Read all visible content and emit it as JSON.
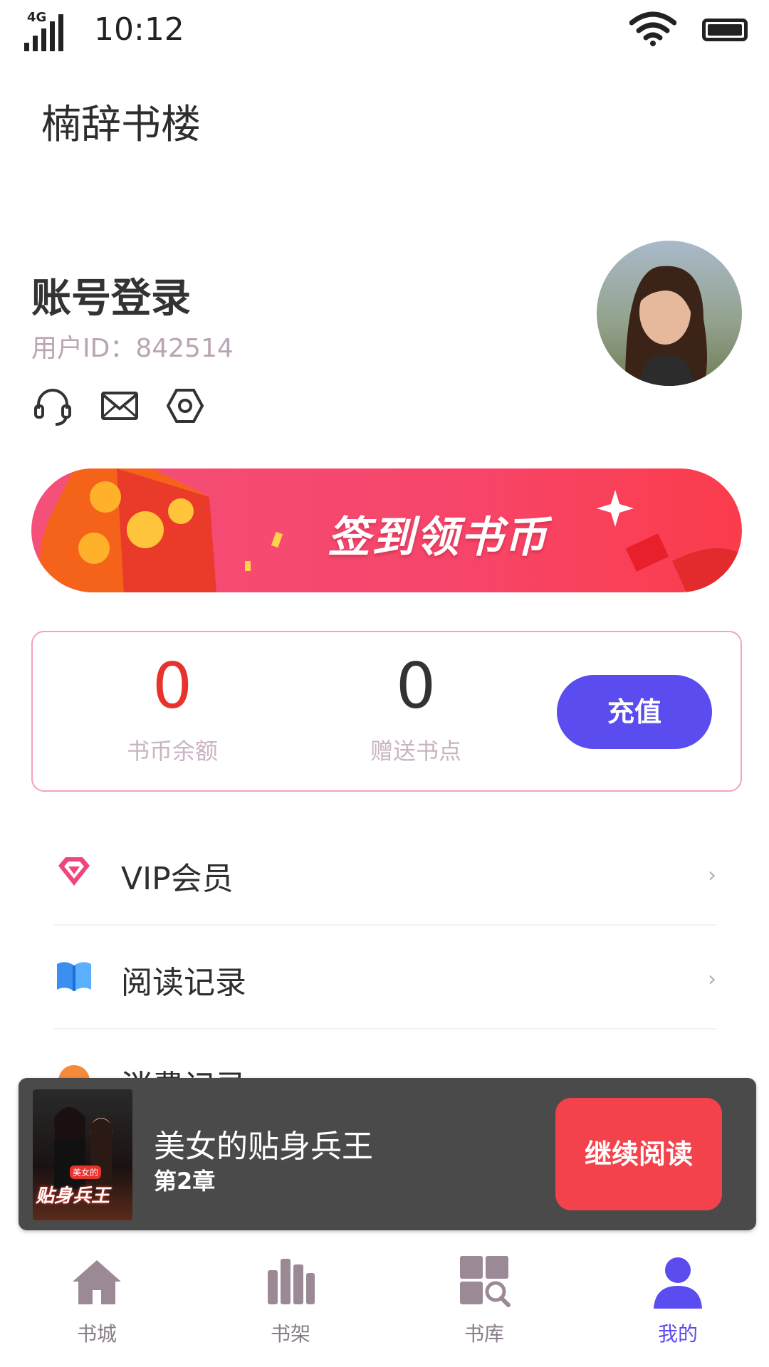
{
  "status_bar": {
    "network": "4G",
    "time": "10:12"
  },
  "app_title": "楠辞书楼",
  "profile": {
    "account_title": "账号登录",
    "user_id": "用户ID：842514",
    "icons": [
      "headset-icon",
      "mail-icon",
      "settings-icon"
    ]
  },
  "banner": {
    "text": "签到领书币"
  },
  "wallet": {
    "balance_value": "0",
    "balance_label": "书币余额",
    "gift_value": "0",
    "gift_label": "赠送书点",
    "recharge_label": "充值",
    "colors": {
      "balance": "#e8322d",
      "gift": "#333333",
      "recharge": "#5a4cee"
    }
  },
  "menu": [
    {
      "label": "VIP会员",
      "icon": "diamond-icon"
    },
    {
      "label": "阅读记录",
      "icon": "book-icon"
    },
    {
      "label": "消费记录",
      "icon": "coin-icon"
    }
  ],
  "continue_reading": {
    "book_title": "美女的贴身兵王",
    "chapter": "第2章",
    "cover_text": "贴身兵王",
    "cover_tag": "美女的",
    "button_label": "继续阅读"
  },
  "tabs": [
    {
      "label": "书城",
      "icon": "home-icon",
      "active": false
    },
    {
      "label": "书架",
      "icon": "bookshelf-icon",
      "active": false
    },
    {
      "label": "书库",
      "icon": "library-search-icon",
      "active": false
    },
    {
      "label": "我的",
      "icon": "user-icon",
      "active": true
    }
  ]
}
